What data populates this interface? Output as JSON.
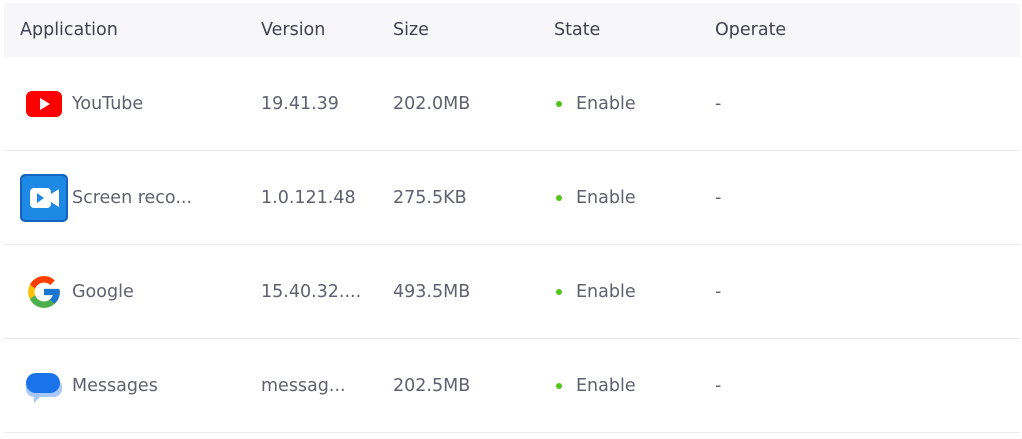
{
  "columns": {
    "application": "Application",
    "version": "Version",
    "size": "Size",
    "state": "State",
    "operate": "Operate"
  },
  "rows": [
    {
      "icon": "youtube-icon",
      "name": "YouTube",
      "version": "19.41.39",
      "size": "202.0MB",
      "state": "Enable",
      "operate": "-"
    },
    {
      "icon": "screen-recorder-icon",
      "name": "Screen reco...",
      "version": "1.0.121.48",
      "size": "275.5KB",
      "state": "Enable",
      "operate": "-"
    },
    {
      "icon": "google-icon",
      "name": "Google",
      "version": "15.40.32....",
      "size": "493.5MB",
      "state": "Enable",
      "operate": "-"
    },
    {
      "icon": "messages-icon",
      "name": "Messages",
      "version": "messag...",
      "size": "202.5MB",
      "state": "Enable",
      "operate": "-"
    }
  ],
  "colors": {
    "state_dot": "#52c41a",
    "header_bg": "#f7f7f9"
  }
}
